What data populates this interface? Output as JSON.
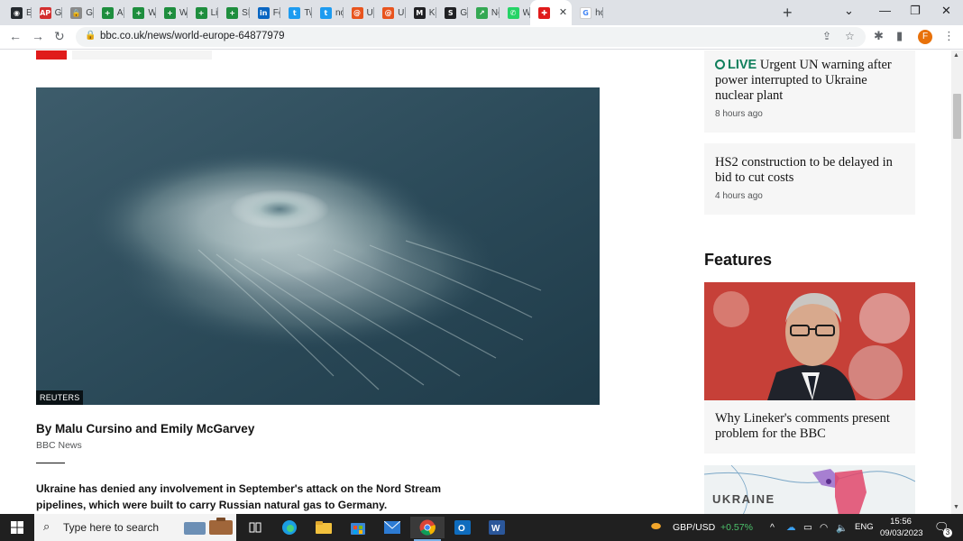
{
  "browser": {
    "tabs": [
      {
        "label": "Edi",
        "icon": "github-icon",
        "color": "#24292e",
        "glyph": "◉"
      },
      {
        "label": "Ge",
        "icon": "ap-news-icon",
        "color": "#d32f2f",
        "glyph": "AP"
      },
      {
        "label": "Ge",
        "icon": "lock-icon",
        "color": "#8a8a8a",
        "glyph": "🔒"
      },
      {
        "label": "Att",
        "icon": "plus-doc-icon",
        "color": "#1e8e3e",
        "glyph": "+"
      },
      {
        "label": "We",
        "icon": "plus-doc-icon",
        "color": "#1e8e3e",
        "glyph": "+"
      },
      {
        "label": "We",
        "icon": "plus-doc-icon",
        "color": "#1e8e3e",
        "glyph": "+"
      },
      {
        "label": "Lin",
        "icon": "plus-doc-icon",
        "color": "#1e8e3e",
        "glyph": "+"
      },
      {
        "label": "SEC",
        "icon": "plus-doc-icon",
        "color": "#1e8e3e",
        "glyph": "+"
      },
      {
        "label": "Fee",
        "icon": "linkedin-icon",
        "color": "#0a66c2",
        "glyph": "in"
      },
      {
        "label": "Tw",
        "icon": "twitter-icon",
        "color": "#1d9bf0",
        "glyph": "t"
      },
      {
        "label": "nor",
        "icon": "twitter-bird-icon",
        "color": "#1d9bf0",
        "glyph": "t"
      },
      {
        "label": "UR",
        "icon": "spiral-icon",
        "color": "#e8541e",
        "glyph": "@"
      },
      {
        "label": "UR",
        "icon": "spiral-icon",
        "color": "#e8541e",
        "glyph": "@"
      },
      {
        "label": "Key",
        "icon": "mail-icon",
        "color": "#202124",
        "glyph": "M"
      },
      {
        "label": "Gas",
        "icon": "s-logo-icon",
        "color": "#202124",
        "glyph": "S"
      },
      {
        "label": "No",
        "icon": "trend-icon",
        "color": "#34a853",
        "glyph": "↗"
      },
      {
        "label": "Wh",
        "icon": "whatsapp-icon",
        "color": "#25d366",
        "glyph": "✆"
      },
      {
        "label": "",
        "icon": "bbc-plus-icon",
        "color": "#e01b1b",
        "glyph": "✚",
        "active": true
      },
      {
        "label": "hov",
        "icon": "google-icon",
        "color": "#ffffff",
        "glyph": "G"
      }
    ],
    "url": "bbc.co.uk/news/world-europe-64877979"
  },
  "article": {
    "image_credit": "REUTERS",
    "byline": "By Malu Cursino and Emily McGarvey",
    "byline_source": "BBC News",
    "lede": "Ukraine has denied any involvement in September's attack on the Nord Stream pipelines, which were built to carry Russian natural gas to Germany."
  },
  "sidebar": {
    "cards": [
      {
        "live_label": "LIVE",
        "title": "Urgent UN warning after power interrupted to Ukraine nuclear plant",
        "time": "8 hours ago"
      },
      {
        "title": "HS2 construction to be delayed in bid to cut costs",
        "time": "4 hours ago"
      }
    ],
    "features_heading": "Features",
    "feature_card_title": "Why Lineker's comments present problem for the BBC",
    "map_label": "UKRAINE"
  },
  "taskbar": {
    "search_placeholder": "Type here to search",
    "ticker_name": "GBP/USD",
    "ticker_change": "+0.57%",
    "language": "ENG",
    "time": "15:56",
    "date": "09/03/2023",
    "notification_count": "3"
  },
  "colors": {
    "bbc_red": "#e01b1b",
    "live_green": "#0f7f5c",
    "ticker_green": "#4cc26b"
  }
}
